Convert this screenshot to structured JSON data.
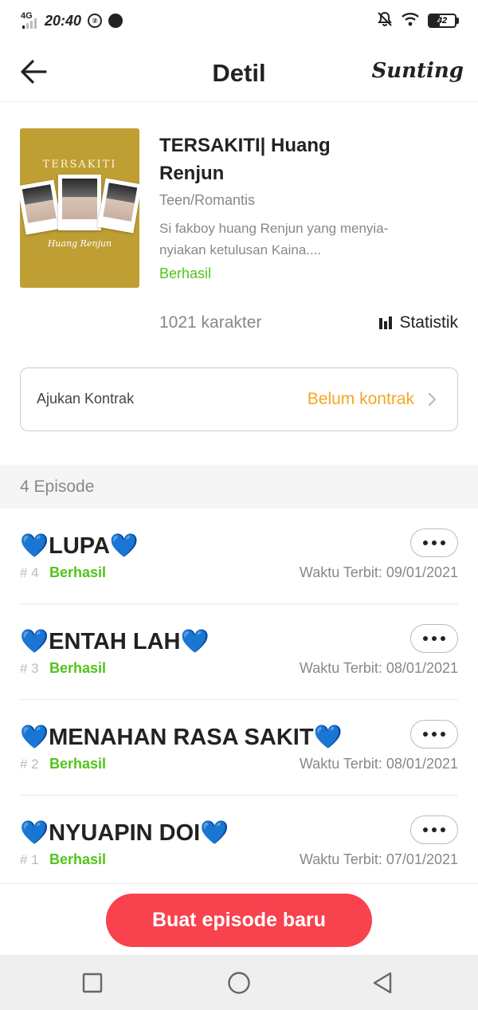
{
  "status_bar": {
    "network": "4G",
    "time": "20:40",
    "notif_badge": "②",
    "battery": "42",
    "battery_level": 0.42
  },
  "header": {
    "title": "Detil",
    "edit_label": "Sunting"
  },
  "book": {
    "cover_title": "TERSAKITI",
    "cover_author": "Huang Renjun",
    "title": "TERSAKITI| Huang Renjun",
    "genre": "Teen/Romantis",
    "description": "Si fakboy huang Renjun yang menyia-nyiakan ketulusan Kaina....",
    "status": "Berhasil",
    "char_count": "1021 karakter",
    "stats_label": "Statistik"
  },
  "contract": {
    "label": "Ajukan Kontrak",
    "value": "Belum kontrak"
  },
  "episodes_header": "4 Episode",
  "episodes": [
    {
      "title_pre": "💙",
      "title": "LUPA",
      "title_post": "💙",
      "num": "# 4",
      "status": "Berhasil",
      "date": "Waktu Terbit: 09/01/2021"
    },
    {
      "title_pre": "💙",
      "title": "ENTAH LAH ",
      "title_post": "💙",
      "num": "# 3",
      "status": "Berhasil",
      "date": "Waktu Terbit: 08/01/2021"
    },
    {
      "title_pre": "💙",
      "title": "MENAHAN RASA SAKIT",
      "title_post": "💙",
      "num": "# 2",
      "status": "Berhasil",
      "date": "Waktu Terbit: 08/01/2021"
    },
    {
      "title_pre": "💙",
      "title": "NYUAPIN DOI",
      "title_post": "💙",
      "num": "# 1",
      "status": "Berhasil",
      "date": "Waktu Terbit: 07/01/2021"
    }
  ],
  "new_episode_label": "Buat episode baru",
  "colors": {
    "accent_red": "#f8424d",
    "success_green": "#52c41a",
    "warning_orange": "#f5a623",
    "heart_blue": "#1b7fe0"
  },
  "icons": {
    "back": "arrow-left-icon",
    "stats": "bar-chart-icon",
    "chevron": "chevron-right-icon",
    "more": "more-dots-icon",
    "heart": "blue-heart-icon"
  }
}
